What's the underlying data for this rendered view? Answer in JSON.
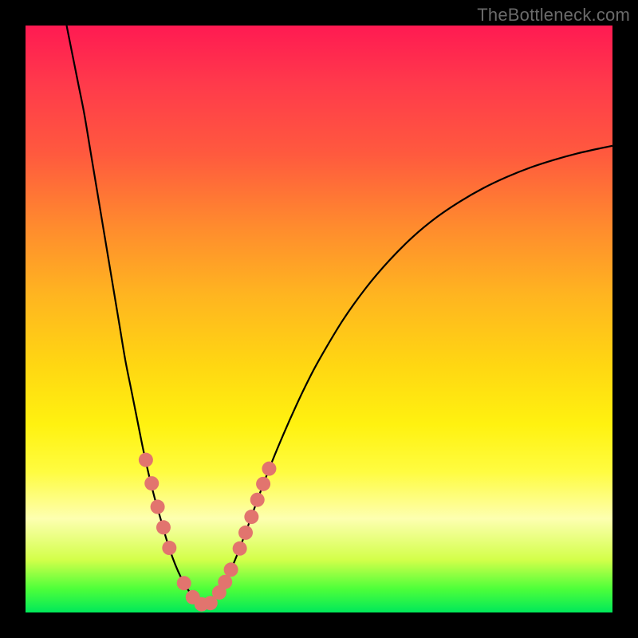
{
  "watermark": "TheBottleneck.com",
  "colors": {
    "background": "#000000",
    "grad_top": "#ff1a52",
    "grad_bottom": "#00e85a",
    "curve": "#000000",
    "marker": "#e2746e"
  },
  "chart_data": {
    "type": "line",
    "title": "",
    "xlabel": "",
    "ylabel": "",
    "xlim": [
      0,
      100
    ],
    "ylim": [
      0,
      100
    ],
    "minimum_x": 30,
    "series": [
      {
        "name": "bottleneck-curve",
        "x": [
          7,
          8,
          9,
          10,
          11,
          12,
          13,
          14,
          15,
          16,
          17,
          18,
          19,
          20,
          21,
          22,
          23,
          24,
          25,
          26,
          27,
          28,
          29,
          30,
          31,
          32,
          33,
          34,
          35,
          36,
          37,
          38,
          40,
          42,
          44,
          46,
          48,
          50,
          54,
          58,
          62,
          66,
          70,
          74,
          78,
          82,
          86,
          90,
          94,
          98,
          100
        ],
        "y": [
          100,
          95,
          90,
          85,
          79,
          73,
          67,
          61,
          55,
          49,
          43,
          38,
          33,
          28,
          23.5,
          19.5,
          16,
          12.5,
          9.5,
          7,
          5,
          3.4,
          2.1,
          1.4,
          1.4,
          2.1,
          3.4,
          5.2,
          7.3,
          9.7,
          12.3,
          15,
          20.5,
          25.7,
          30.5,
          35,
          39.2,
          43,
          49.7,
          55.3,
          60,
          64,
          67.3,
          70,
          72.3,
          74.2,
          75.8,
          77.1,
          78.2,
          79.1,
          79.5
        ]
      }
    ],
    "markers": {
      "name": "highlighted-points",
      "x": [
        20.5,
        21.5,
        22.5,
        23.5,
        24.5,
        27,
        28.5,
        30,
        31.5,
        33,
        34,
        35,
        36.5,
        37.5,
        38.5,
        39.5,
        40.5,
        41.5
      ],
      "y": [
        26,
        22,
        18,
        14.5,
        11,
        5,
        2.6,
        1.4,
        1.6,
        3.4,
        5.2,
        7.3,
        10.9,
        13.6,
        16.3,
        19.2,
        21.9,
        24.5
      ]
    }
  }
}
